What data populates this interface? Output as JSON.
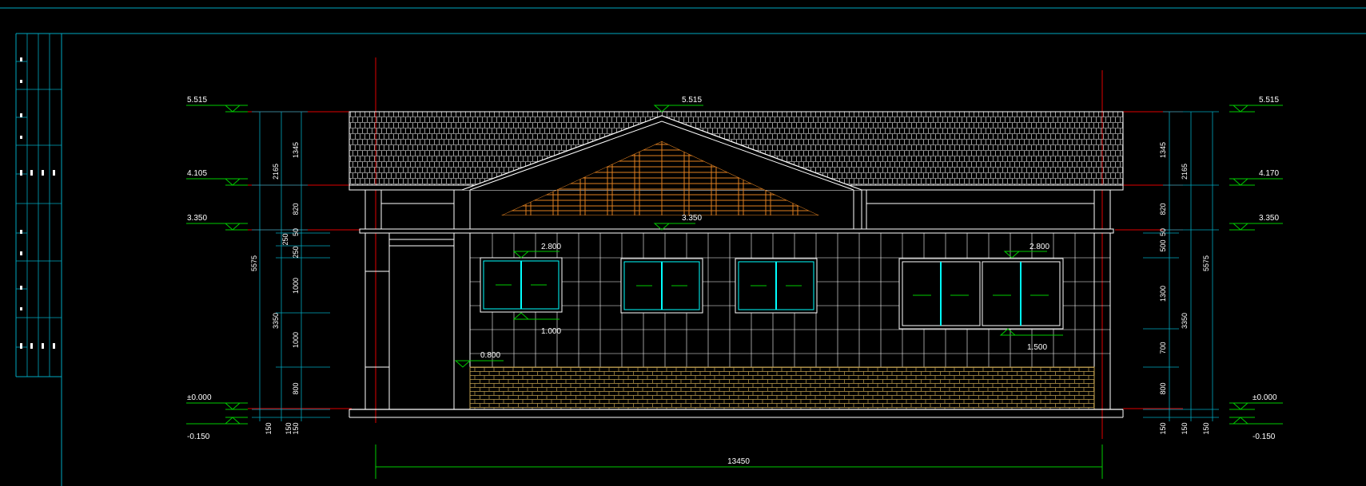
{
  "colors": {
    "background": "#000000",
    "frame": "#00a8c0",
    "grid_axis": "#e00000",
    "building": "#ffffff",
    "elevation_marker": "#00cc00",
    "dim_line": "#00a8c0",
    "gable_slats": "#e08020",
    "brick": "#c0a050",
    "glass": "#00ffff"
  },
  "elevation_markers": [
    {
      "side": "left",
      "label": "5.515"
    },
    {
      "side": "left",
      "label": "4.105"
    },
    {
      "side": "left",
      "label": "3.350"
    },
    {
      "side": "left",
      "label": "±0.000"
    },
    {
      "side": "left",
      "label": "-0.150"
    },
    {
      "side": "right",
      "label": "5.515"
    },
    {
      "side": "right",
      "label": "4.170"
    },
    {
      "side": "right",
      "label": "3.350"
    },
    {
      "side": "right",
      "label": "±0.000"
    },
    {
      "side": "right",
      "label": "-0.150"
    },
    {
      "side": "ridge",
      "label": "5.515"
    },
    {
      "side": "porch",
      "label": "3.350"
    },
    {
      "side": "window-top-1",
      "label": "2.800"
    },
    {
      "side": "window-top-2",
      "label": "2.800"
    },
    {
      "side": "window-sill-1",
      "label": "1.000"
    },
    {
      "side": "window-sill-2",
      "label": "1.500"
    },
    {
      "side": "wainscot",
      "label": "0.800"
    }
  ],
  "dimensions": {
    "left_total": "5575",
    "left_upper": "2165",
    "left_lower": "3350",
    "left_segments": [
      "1345",
      "820",
      "50",
      "250",
      "250",
      "1000",
      "1000",
      "800"
    ],
    "left_bottom": [
      "150",
      "150",
      "150"
    ],
    "right_total": "5575",
    "right_upper": "2165",
    "right_lower": "3350",
    "right_segments": [
      "1345",
      "820",
      "50",
      "500",
      "1300",
      "700",
      "800"
    ],
    "right_bottom": [
      "150",
      "150",
      "150"
    ],
    "overall_width": "13450"
  }
}
